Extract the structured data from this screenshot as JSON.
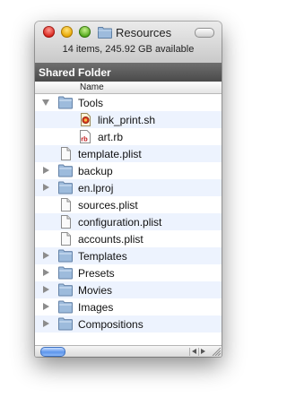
{
  "window": {
    "title": "Resources",
    "status": "14 items, 245.92 GB available"
  },
  "sidebar": {
    "header": "Shared Folder"
  },
  "columns": {
    "name": "Name"
  },
  "rows": [
    {
      "label": "Tools",
      "kind": "folder",
      "depth": 0,
      "expanded": true
    },
    {
      "label": "link_print.sh",
      "kind": "script",
      "depth": 1
    },
    {
      "label": "art.rb",
      "kind": "ruby",
      "depth": 1
    },
    {
      "label": "template.plist",
      "kind": "file",
      "depth": 0
    },
    {
      "label": "backup",
      "kind": "folder",
      "depth": 0,
      "expanded": false
    },
    {
      "label": "en.lproj",
      "kind": "folder",
      "depth": 0,
      "expanded": false
    },
    {
      "label": "sources.plist",
      "kind": "file",
      "depth": 0
    },
    {
      "label": "configuration.plist",
      "kind": "file",
      "depth": 0
    },
    {
      "label": "accounts.plist",
      "kind": "file",
      "depth": 0
    },
    {
      "label": "Templates",
      "kind": "folder",
      "depth": 0,
      "expanded": false
    },
    {
      "label": "Presets",
      "kind": "folder",
      "depth": 0,
      "expanded": false
    },
    {
      "label": "Movies",
      "kind": "folder",
      "depth": 0,
      "expanded": false
    },
    {
      "label": "Images",
      "kind": "folder",
      "depth": 0,
      "expanded": false
    },
    {
      "label": "Compositions",
      "kind": "folder",
      "depth": 0,
      "expanded": false
    }
  ],
  "icons": {
    "folder": "folder-icon",
    "file": "document-icon",
    "script": "shell-script-icon",
    "ruby": "ruby-file-icon",
    "ruby_badge": "rb"
  },
  "colors": {
    "folder": "#8fb3d9",
    "stripe": "#edf3fe",
    "header": "#5a5a5a"
  }
}
